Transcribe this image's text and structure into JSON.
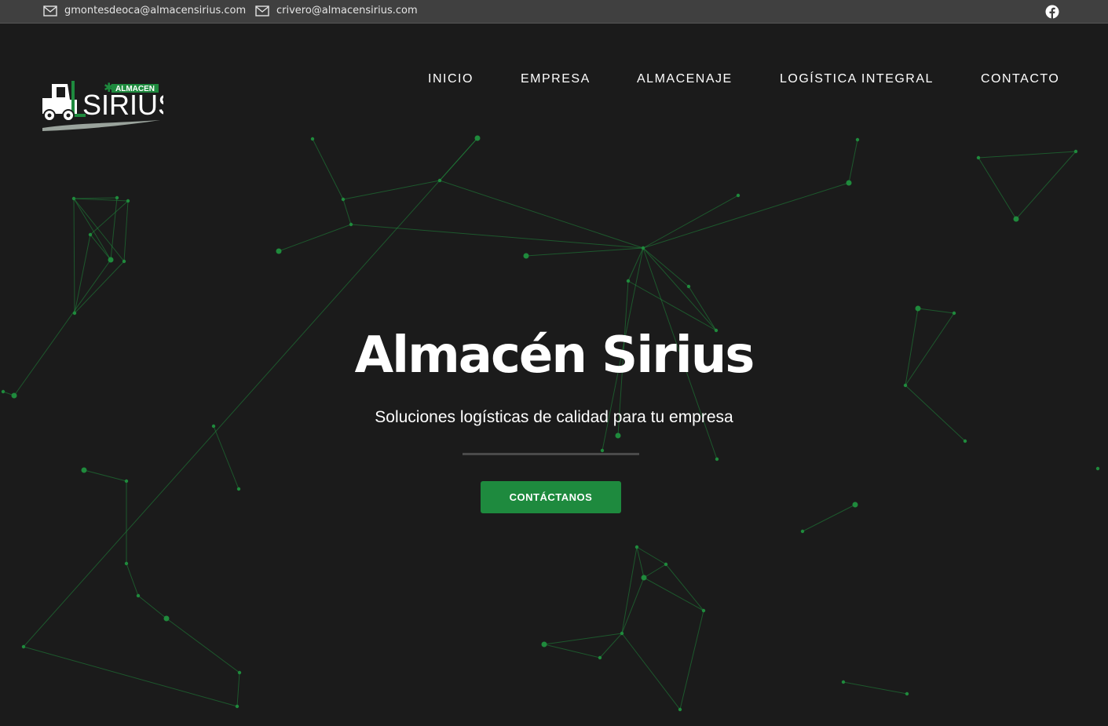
{
  "topbar": {
    "emails": [
      "gmontesdeoca@almacensirius.com",
      "crivero@almacensirius.com"
    ],
    "social_icon": "facebook-icon"
  },
  "logo": {
    "tag": "ALMACEN",
    "brand": "SIRIUS",
    "icon": "forklift-icon"
  },
  "nav": {
    "items": [
      "INICIO",
      "EMPRESA",
      "ALMACENAJE",
      "LOGÍSTICA INTEGRAL",
      "CONTACTO"
    ]
  },
  "hero": {
    "title": "Almacén Sirius",
    "subtitle": "Soluciones logísticas de calidad para tu empresa",
    "cta_label": "CONTÁCTANOS"
  },
  "colors": {
    "accent": "#1e8a3e",
    "background": "#1b1b1b",
    "topbar": "#404040",
    "network": "#1f8a3c"
  }
}
